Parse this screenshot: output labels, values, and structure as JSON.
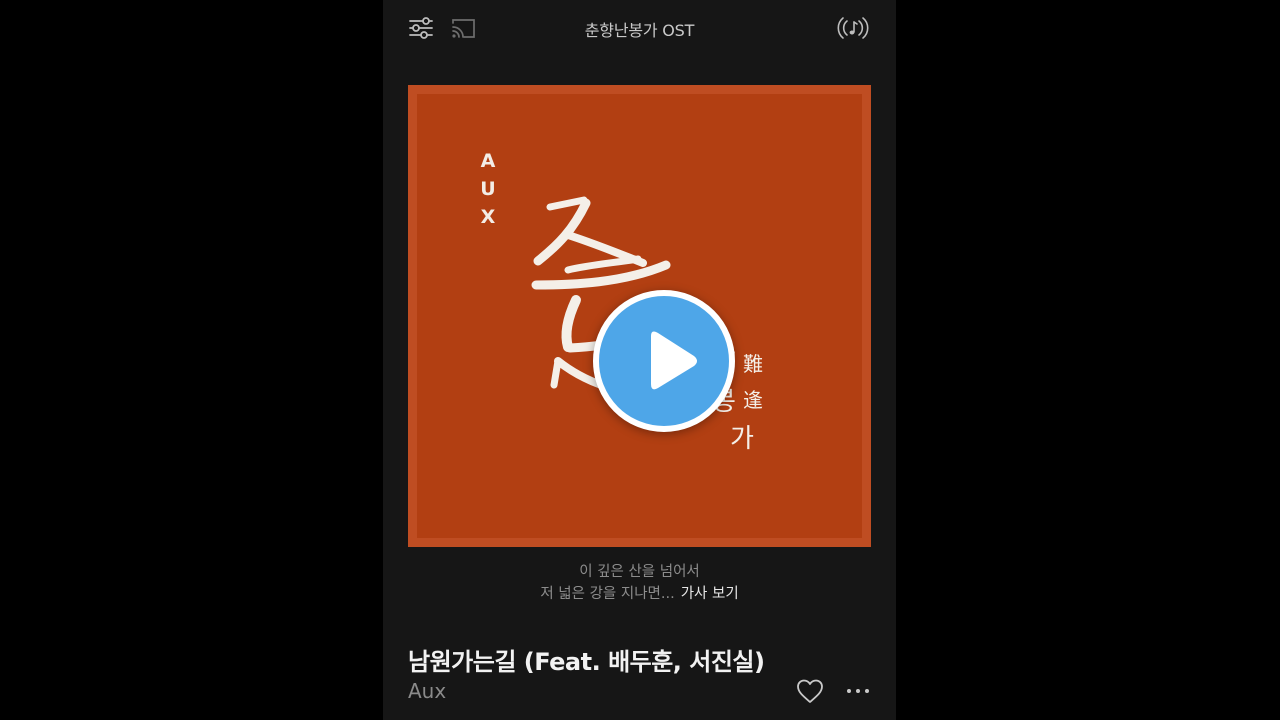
{
  "header": {
    "title": "춘향난봉가 OST",
    "left_icons": [
      "equalizer-icon",
      "cast-icon"
    ],
    "right_icon": "live-music-icon"
  },
  "album_art": {
    "artist_text": "AUX",
    "hanja": [
      "難",
      "逢"
    ],
    "hangul": [
      "난",
      "봉",
      "가"
    ],
    "background_color": "#b23f12"
  },
  "player": {
    "play_icon": "play-icon",
    "accent_color": "#4ea6e8"
  },
  "lyrics": {
    "line1": "이 깊은 산을 넘어서",
    "line2": "저 넓은 강을 지나면...",
    "more_label": "가사 보기"
  },
  "track": {
    "title": "남원가는길 (Feat. 배두훈, 서진실)",
    "artist": "Aux",
    "actions": [
      "heart-icon",
      "more-icon"
    ]
  }
}
